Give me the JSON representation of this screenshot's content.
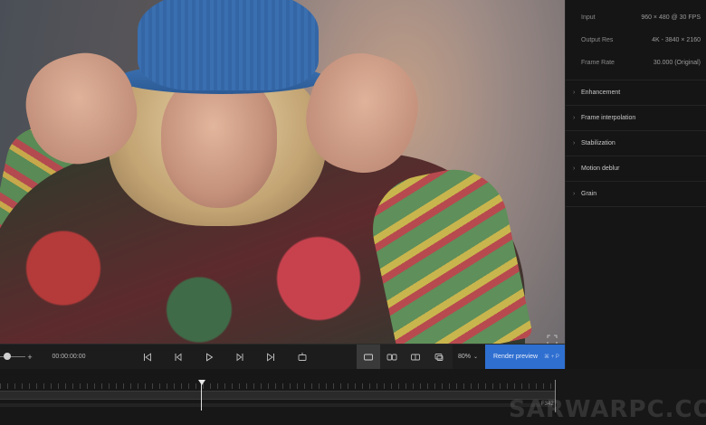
{
  "panel": {
    "info": [
      {
        "label": "Input",
        "value": "960 × 480 @ 30 FPS"
      },
      {
        "label": "Output Res",
        "value": "4K - 3840 × 2160"
      },
      {
        "label": "Frame Rate",
        "value": "30.000 (Original)"
      }
    ],
    "sections": [
      "Enhancement",
      "Frame interpolation",
      "Stabilization",
      "Motion deblur",
      "Grain"
    ]
  },
  "controls": {
    "plus_label": "+",
    "timecode": "00:00:00:00",
    "zoom": "80%",
    "render_label": "Render preview",
    "render_shortcut": "⌘ + P"
  },
  "timeline": {
    "frame_label": "F342"
  },
  "watermark": "SARWARPC.CO",
  "colors": {
    "accent": "#2f6fd0",
    "background": "#141414"
  }
}
